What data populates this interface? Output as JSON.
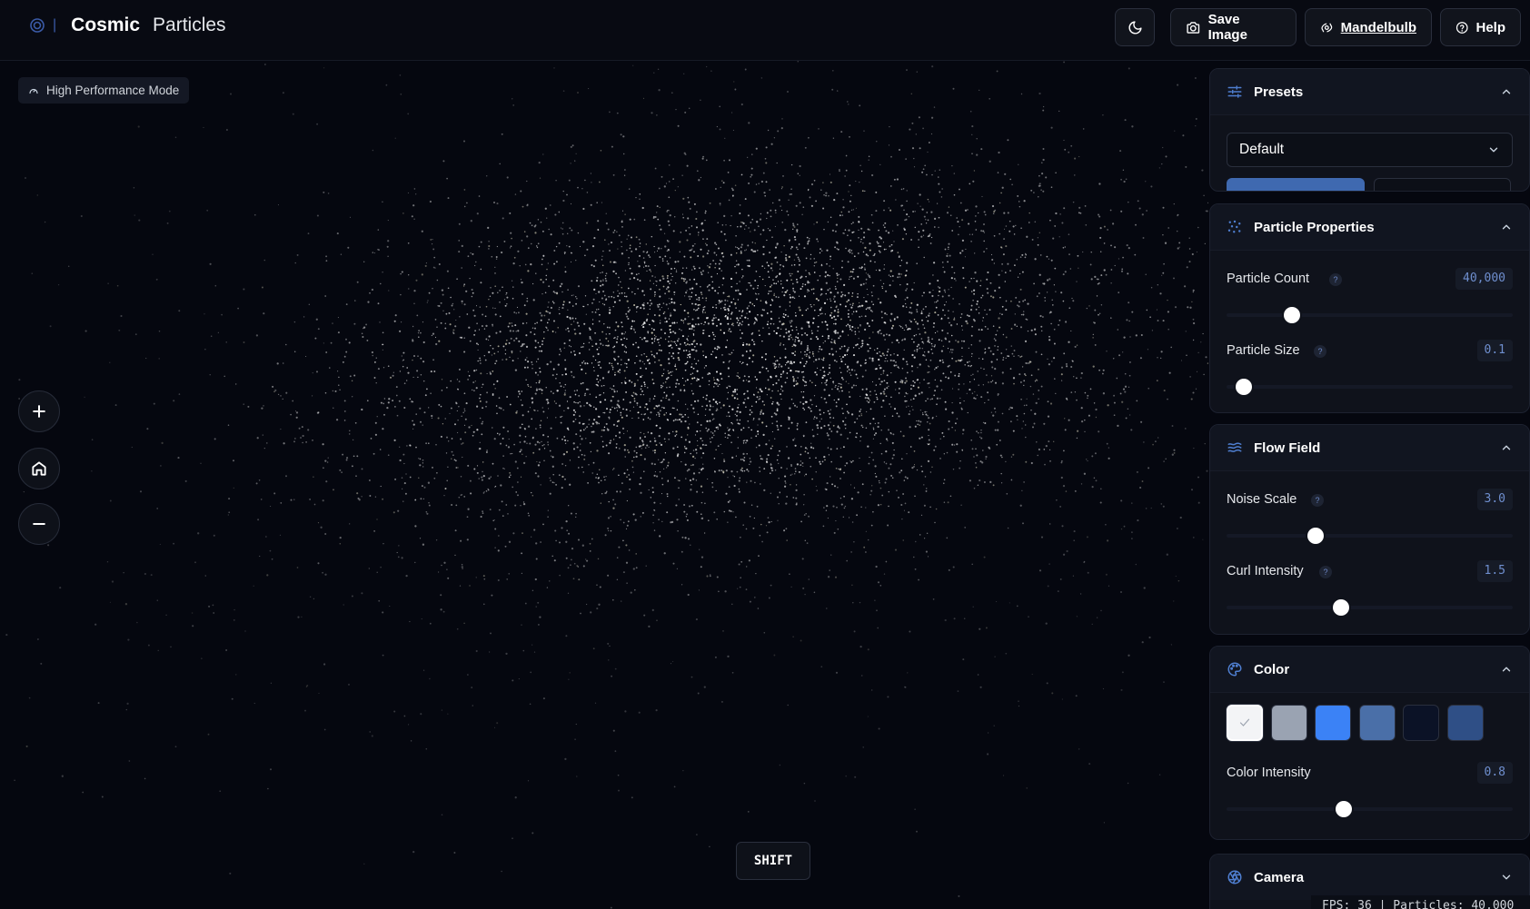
{
  "header": {
    "title_bold": "Cosmic",
    "title_rest": "Particles",
    "separator": "|",
    "save_image_label": "Save Image",
    "mandelbulb_label": "Mandelbulb",
    "help_label": "Help"
  },
  "performance_badge": "High Performance Mode",
  "shift_key": "SHIFT",
  "status_text": "FPS: 36 | Particles: 40,000",
  "panels": {
    "presets": {
      "title": "Presets",
      "selected": "Default"
    },
    "particle_properties": {
      "title": "Particle Properties",
      "particle_count": {
        "label": "Particle Count",
        "help": "?",
        "value": "40,000",
        "fraction": 0.2
      },
      "particle_size": {
        "label": "Particle Size",
        "help": "?",
        "value": "0.1",
        "fraction": 0.03
      }
    },
    "flow_field": {
      "title": "Flow Field",
      "noise_scale": {
        "label": "Noise Scale",
        "help": "?",
        "value": "3.0",
        "fraction": 0.28
      },
      "curl_intensity": {
        "label": "Curl Intensity",
        "help": "?",
        "value": "1.5",
        "fraction": 0.37
      }
    },
    "color": {
      "title": "Color",
      "swatches": [
        "#f3f4f6",
        "#9aa3b2",
        "#3b82f6",
        "#4a6fa8",
        "#0b1226",
        "#2f4f86"
      ],
      "selected_swatch": 0,
      "color_intensity": {
        "label": "Color Intensity",
        "value": "0.8",
        "fraction": 0.38
      }
    },
    "camera": {
      "title": "Camera"
    }
  },
  "accent_color": "#4f7fd1"
}
